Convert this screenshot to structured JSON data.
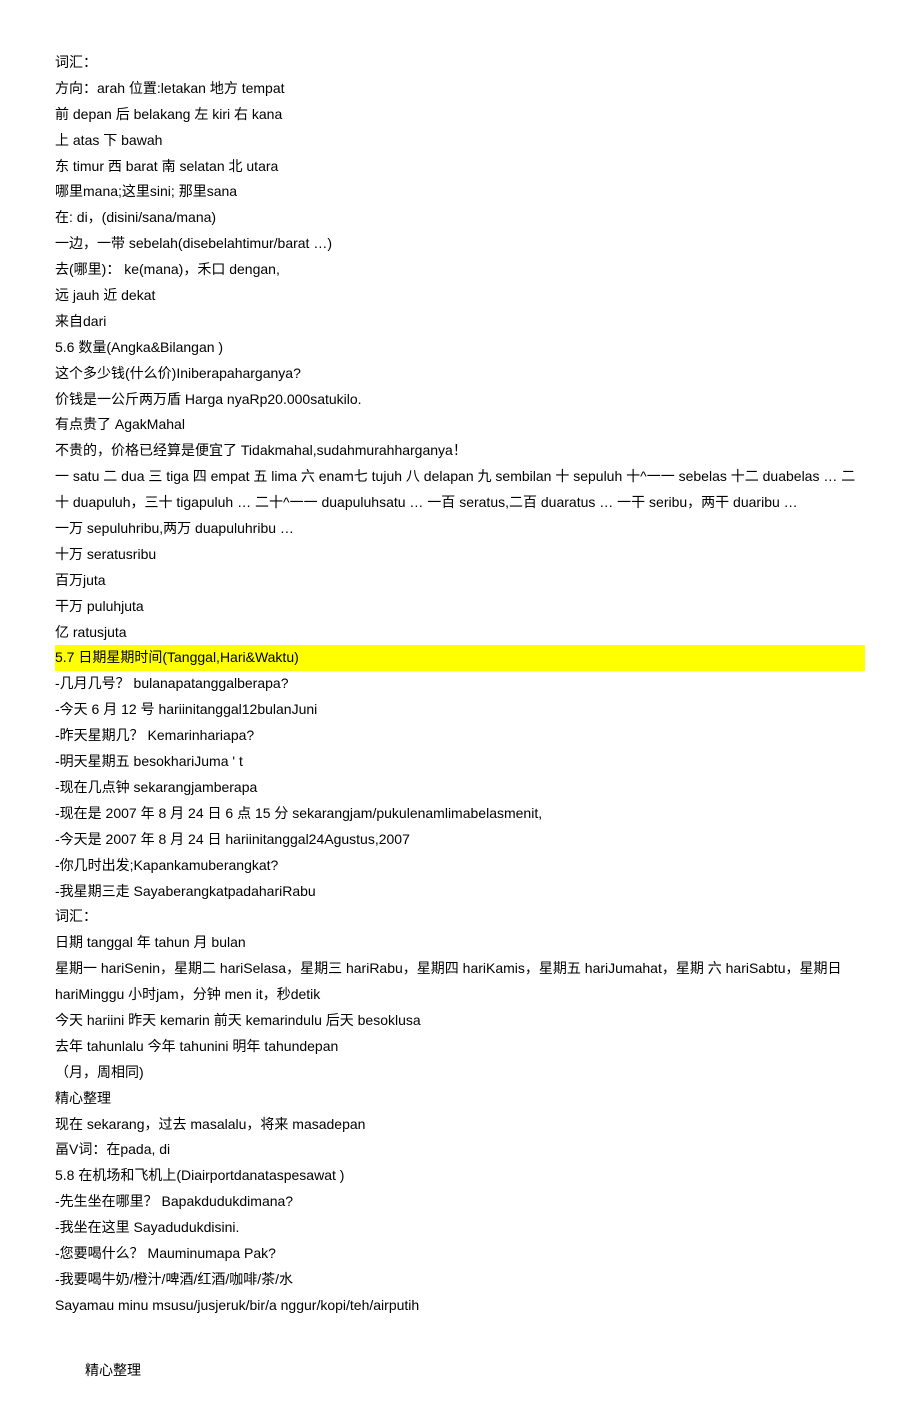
{
  "lines": [
    {
      "text": "词汇：",
      "cls": "line"
    },
    {
      "text": "方向：arah 位置:letakan 地方 tempat",
      "cls": "line"
    },
    {
      "text": "前 depan 后 belakang 左 kiri 右 kana",
      "cls": "line"
    },
    {
      "text": "上 atas 下 bawah",
      "cls": "line"
    },
    {
      "text": "东 timur 西 barat 南 selatan 北 utara",
      "cls": "line"
    },
    {
      "text": "哪里mana;这里sini; 那里sana",
      "cls": "line"
    },
    {
      "text": "在: di，(disini/sana/mana)",
      "cls": "line"
    },
    {
      "text": "一边，一带 sebelah(disebelahtimur/barat …)",
      "cls": "line"
    },
    {
      "text": "去(哪里)： ke(mana)，禾口 dengan,",
      "cls": "line"
    },
    {
      "text": "远 jauh 近 dekat",
      "cls": "line"
    },
    {
      "text": "来自dari",
      "cls": "line"
    },
    {
      "text": "5.6   数量(Angka&Bilangan )",
      "cls": "line"
    },
    {
      "text": "这个多少钱(什么价)Iniberapaharganya?",
      "cls": "line"
    },
    {
      "text": "价钱是一公斤两万盾 Harga nyaRp20.000satukilo.",
      "cls": "line"
    },
    {
      "text": "有点贵了 AgakMahal",
      "cls": "line"
    },
    {
      "text": "不贵的，价格已经算是便宜了          Tidakmahal,sudahmurahharganya！",
      "cls": "line"
    },
    {
      "text": "一 satu 二 dua 三 tiga 四 empat 五 lima 六 enam七 tujuh 八 delapan 九 sembilan 十 sepuluh 十^一一 sebelas 十二 duabelas … 二十 duapuluh，三十 tigapuluh … 二十^一一 duapuluhsatu … 一百 seratus,二百 duaratus … 一干 seribu，两干 duaribu …",
      "cls": "line"
    },
    {
      "text": "一万 sepuluhribu,两万 duapuluhribu …",
      "cls": "line"
    },
    {
      "text": "十万 seratusribu",
      "cls": "line"
    },
    {
      "text": "百万juta",
      "cls": "line"
    },
    {
      "text": "干万 puluhjuta",
      "cls": "line"
    },
    {
      "text": "亿 ratusjuta",
      "cls": "line"
    },
    {
      "text": "5.7   日期星期时间(Tanggal,Hari&Waktu)",
      "cls": "highlight"
    },
    {
      "text": "-几月几号？ bulanapatanggalberapa?",
      "cls": "line"
    },
    {
      "text": "-今天 6 月 12 号 hariinitanggal12bulanJuni",
      "cls": "line"
    },
    {
      "text": "-昨天星期几？ Kemarinhariapa?",
      "cls": "line"
    },
    {
      "text": "-明天星期五 besokhariJuma ' t",
      "cls": "line"
    },
    {
      "text": "-现在几点钟 sekarangjamberapa",
      "cls": "line"
    },
    {
      "text": "-现在是 2007 年 8 月 24 日 6 点 15 分 sekarangjam/pukulenamlimabelasmenit,",
      "cls": "line"
    },
    {
      "text": "-今天是 2007 年 8 月 24 日 hariinitanggal24Agustus,2007",
      "cls": "line"
    },
    {
      "text": "-你几时出发;Kapankamuberangkat?",
      "cls": "line"
    },
    {
      "text": "-我星期三走 SayaberangkatpadahariRabu",
      "cls": "line"
    },
    {
      "text": "词汇：",
      "cls": "line"
    },
    {
      "text": "日期 tanggal 年 tahun 月 bulan",
      "cls": "line"
    },
    {
      "text": "星期一 hariSenin，星期二 hariSelasa，星期三 hariRabu，星期四 hariKamis，星期五 hariJumahat，星期 六 hariSabtu，星期日 hariMinggu 小时jam，分钟 men it，秒detik",
      "cls": "line"
    },
    {
      "text": "今天 hariini 昨天 kemarin 前天 kemarindulu 后天 besoklusa",
      "cls": "line"
    },
    {
      "text": "去年 tahunlalu 今年 tahunini 明年 tahundepan",
      "cls": "line"
    },
    {
      "text": "（月，周相同)",
      "cls": "line"
    },
    {
      "text": "精心整理",
      "cls": "line"
    },
    {
      "text": "现在 sekarang，过去 masalalu，将来 masadepan",
      "cls": "line"
    },
    {
      "text": "畐V词：在pada, di",
      "cls": "line"
    },
    {
      "text": "5.8   在机场和飞机上(Diairportdanataspesawat )",
      "cls": "line"
    },
    {
      "text": "-先生坐在哪里？ Bapakdudukdimana?",
      "cls": "line"
    },
    {
      "text": "-我坐在这里 Sayadudukdisini.",
      "cls": "line"
    },
    {
      "text": "-您要喝什么？ Mauminumapa Pak?",
      "cls": "line"
    },
    {
      "text": "-我要喝牛奶/橙汁/啤酒/红酒/咖啡/茶/水",
      "cls": "line"
    },
    {
      "text": "Sayamau minu msusu/jusjeruk/bir/a nggur/kopi/teh/airputih",
      "cls": "line"
    }
  ],
  "footer": "精心整理"
}
